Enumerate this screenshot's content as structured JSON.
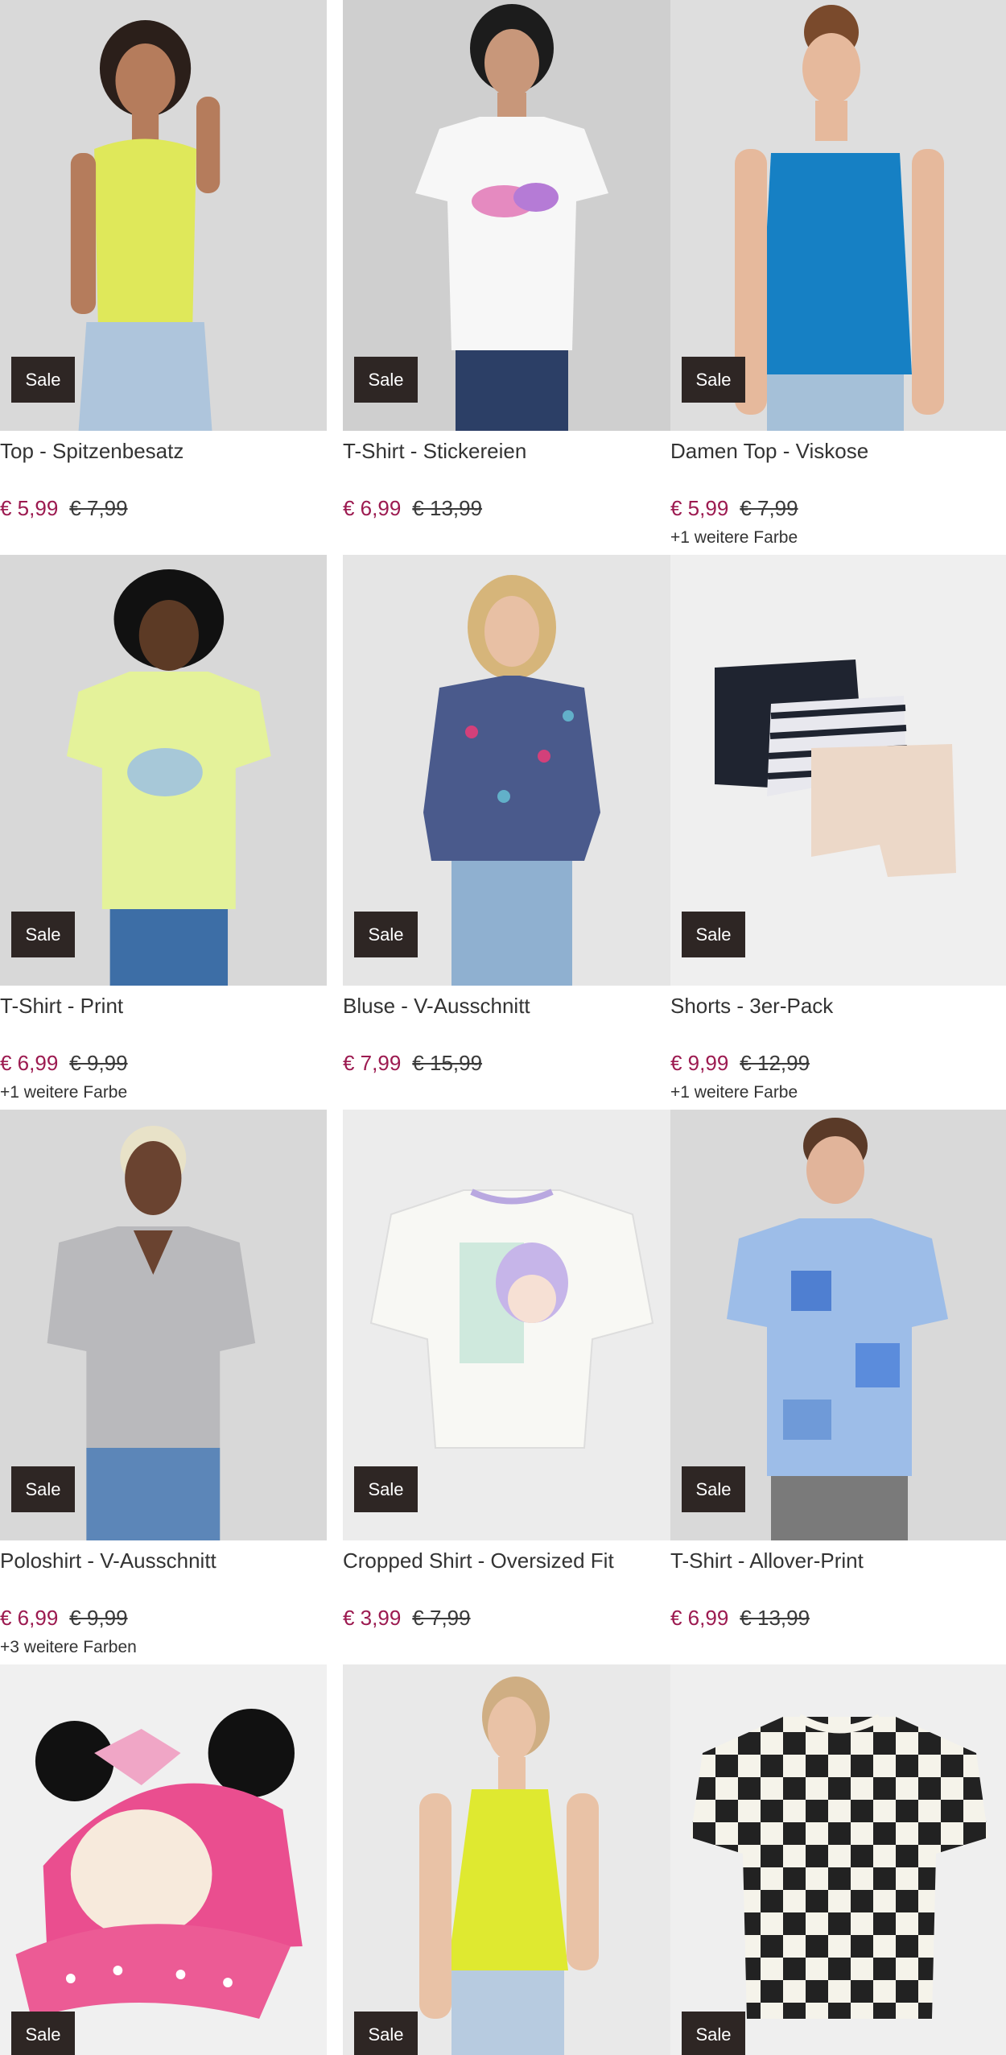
{
  "sale_label": "Sale",
  "products": [
    {
      "title": "Top - Spitzenbesatz",
      "price": "€ 5,99",
      "old_price": "€ 7,99",
      "colors": "",
      "image": "yellow-ruffle-top",
      "bg": "#d9d9d9",
      "garment": "#dfe85a"
    },
    {
      "title": "T-Shirt - Stickereien",
      "price": "€ 6,99",
      "old_price": "€ 13,99",
      "colors": "",
      "image": "white-tshirt-embroidery",
      "bg": "#cfcfcf",
      "garment": "#f7f7f7"
    },
    {
      "title": "Damen Top - Viskose",
      "price": "€ 5,99",
      "old_price": "€ 7,99",
      "colors": "+1 weitere Farbe",
      "image": "blue-viscose-top",
      "bg": "#dedede",
      "garment": "#1680c4"
    },
    {
      "title": "T-Shirt - Print",
      "price": "€ 6,99",
      "old_price": "€ 9,99",
      "colors": "+1 weitere Farbe",
      "image": "lime-tshirt-print",
      "bg": "#d8d8d8",
      "garment": "#e4f29a"
    },
    {
      "title": "Bluse - V-Ausschnitt",
      "price": "€ 7,99",
      "old_price": "€ 15,99",
      "colors": "",
      "image": "floral-blouse",
      "bg": "#e5e5e5",
      "garment": "#4a5a8c"
    },
    {
      "title": "Shorts - 3er-Pack",
      "price": "€ 9,99",
      "old_price": "€ 12,99",
      "colors": "+1 weitere Farbe",
      "image": "shorts-three-pack",
      "bg": "#efefef",
      "garment": "#1f2430"
    },
    {
      "title": "Poloshirt - V-Ausschnitt",
      "price": "€ 6,99",
      "old_price": "€ 9,99",
      "colors": "+3 weitere Farben",
      "image": "grey-polo-shirt",
      "bg": "#d8d8d8",
      "garment": "#b9b9bc"
    },
    {
      "title": "Cropped Shirt - Oversized Fit",
      "price": "€ 3,99",
      "old_price": "€ 7,99",
      "colors": "",
      "image": "white-cropped-anime-shirt",
      "bg": "#ececec",
      "garment": "#f8f8f4"
    },
    {
      "title": "T-Shirt - Allover-Print",
      "price": "€ 6,99",
      "old_price": "€ 13,99",
      "colors": "",
      "image": "blue-patchwork-tshirt",
      "bg": "#d9d9d9",
      "garment": "#9dbde8"
    },
    {
      "title": "",
      "price": "",
      "old_price": "",
      "colors": "",
      "image": "minnie-mouse-cap",
      "bg": "#f0f0f0",
      "garment": "#ea4e8f"
    },
    {
      "title": "",
      "price": "",
      "old_price": "",
      "colors": "",
      "image": "yellow-knit-top",
      "bg": "#e9e9e9",
      "garment": "#dfe930"
    },
    {
      "title": "",
      "price": "",
      "old_price": "",
      "colors": "",
      "image": "checkered-tshirt",
      "bg": "#efefef",
      "garment": "#222222"
    }
  ]
}
